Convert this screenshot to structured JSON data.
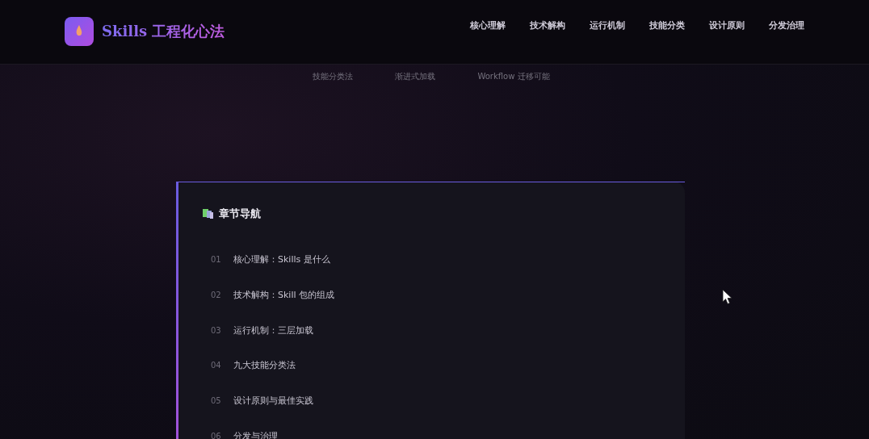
{
  "header": {
    "logo_text": "Skills 工程化心法",
    "nav": [
      "核心理解",
      "技术解构",
      "运行机制",
      "技能分类",
      "设计原则",
      "分发治理"
    ]
  },
  "subnav": [
    "技能分类法",
    "渐进式加载",
    "Workflow 迁移可能"
  ],
  "toc": {
    "title": "章节导航",
    "items": [
      {
        "number": "01",
        "label": "核心理解：Skills 是什么"
      },
      {
        "number": "02",
        "label": "技术解构：Skill 包的组成"
      },
      {
        "number": "03",
        "label": "运行机制：三层加载"
      },
      {
        "number": "04",
        "label": "九大技能分类法"
      },
      {
        "number": "05",
        "label": "设计原则与最佳实践"
      },
      {
        "number": "06",
        "label": "分发与治理"
      }
    ]
  }
}
